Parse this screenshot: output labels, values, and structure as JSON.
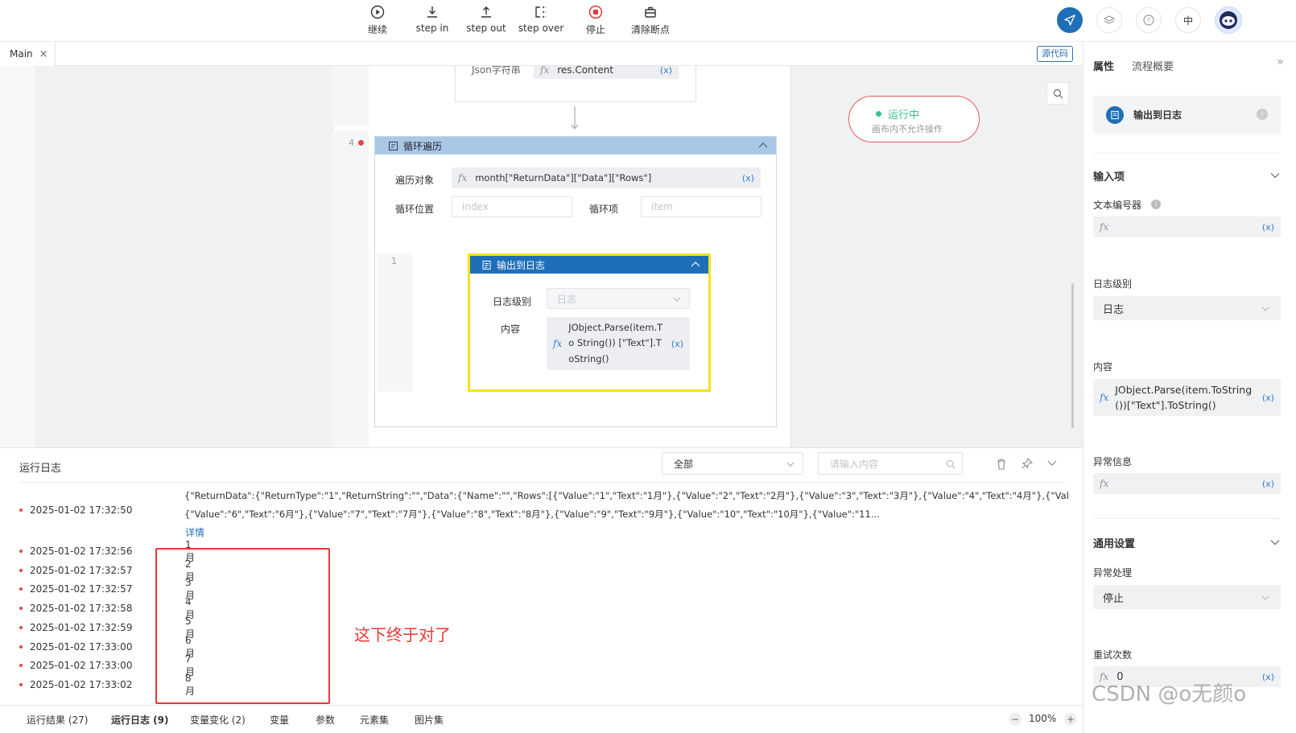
{
  "toolbar": {
    "buttons": [
      {
        "label": "继续",
        "icon": "play-icon"
      },
      {
        "label": "step in",
        "icon": "step-in-icon"
      },
      {
        "label": "step out",
        "icon": "step-out-icon"
      },
      {
        "label": "step over",
        "icon": "step-over-icon"
      },
      {
        "label": "停止",
        "icon": "stop-icon"
      },
      {
        "label": "清除断点",
        "icon": "clear-breakpoints-icon"
      }
    ],
    "lang": "中"
  },
  "tabs": {
    "main": "Main",
    "close": "×",
    "source_btn": "源代码"
  },
  "canvas": {
    "prev_block": {
      "label": "Json字符串",
      "value": "res.Content",
      "x": "(x)"
    },
    "loop": {
      "line_no": "4",
      "title": "循环遍历",
      "traverse_label": "遍历对象",
      "traverse_value": "month[\"ReturnData\"][\"Data\"][\"Rows\"]",
      "x": "(x)",
      "index_label": "循环位置",
      "index_placeholder": "index",
      "item_label": "循环项",
      "item_placeholder": "item"
    },
    "inner": {
      "line_no": "1",
      "title": "输出到日志",
      "level_label": "日志级别",
      "level_value": "日志",
      "content_label": "内容",
      "content_value": "JObject.Parse(item.To String()) [\"Text\"].ToString()",
      "x": "(x)"
    },
    "status": {
      "title": "运行中",
      "subtitle": "画布内不允许操作"
    }
  },
  "log": {
    "title": "运行日志",
    "filter": "全部",
    "search_placeholder": "请输入内容",
    "first": {
      "time": "2025-01-02 17:32:50",
      "line1": "{\"ReturnData\":{\"ReturnType\":\"1\",\"ReturnString\":\"\",\"Data\":{\"Name\":\"\",\"Rows\":[{\"Value\":\"1\",\"Text\":\"1月\"},{\"Value\":\"2\",\"Text\":\"2月\"},{\"Value\":\"3\",\"Text\":\"3月\"},{\"Value\":\"4\",\"Text\":\"4月\"},{\"Value\":\"5\",\"Text\":\"5月\"},",
      "line2": "{\"Value\":\"6\",\"Text\":\"6月\"},{\"Value\":\"7\",\"Text\":\"7月\"},{\"Value\":\"8\",\"Text\":\"8月\"},{\"Value\":\"9\",\"Text\":\"9月\"},{\"Value\":\"10\",\"Text\":\"10月\"},{\"Value\":\"11...",
      "detail": "详情"
    },
    "rows": [
      {
        "time": "2025-01-02 17:32:56",
        "text": "1月"
      },
      {
        "time": "2025-01-02 17:32:57",
        "text": "2月"
      },
      {
        "time": "2025-01-02 17:32:57",
        "text": "3月"
      },
      {
        "time": "2025-01-02 17:32:58",
        "text": "4月"
      },
      {
        "time": "2025-01-02 17:32:59",
        "text": "5月"
      },
      {
        "time": "2025-01-02 17:33:00",
        "text": "6月"
      },
      {
        "time": "2025-01-02 17:33:00",
        "text": "7月"
      },
      {
        "time": "2025-01-02 17:33:02",
        "text": "8月"
      }
    ],
    "annotation": "这下终于对了"
  },
  "bottom_tabs": [
    "运行结果 (27)",
    "运行日志 (9)",
    "变量变化 (2)",
    "变量",
    "参数",
    "元素集",
    "图片集"
  ],
  "zoom": {
    "minus": "−",
    "value": "100%",
    "plus": "+"
  },
  "right_panel": {
    "tabs": [
      "属性",
      "流程概要"
    ],
    "expand": "»",
    "component": "输出到日志",
    "inputs_title": "输入项",
    "text_editor_label": "文本编号器",
    "x": "(x)",
    "log_level_label": "日志级别",
    "log_level_value": "日志",
    "content_label": "内容",
    "content_value": "JObject.Parse(item.ToString())[\"Text\"].ToString()",
    "exception_label": "异常信息",
    "general_title": "通用设置",
    "exception_handle_label": "异常处理",
    "exception_handle_value": "停止",
    "retry_label": "重试次数",
    "retry_value": "0"
  },
  "watermark": "CSDN @o无颜o",
  "colors": {
    "accent": "#1f6fb8",
    "loop_header": "#a9c8e6",
    "highlight": "#f2e21a",
    "annotation": "#e53935",
    "status_green": "#3cc18a"
  }
}
